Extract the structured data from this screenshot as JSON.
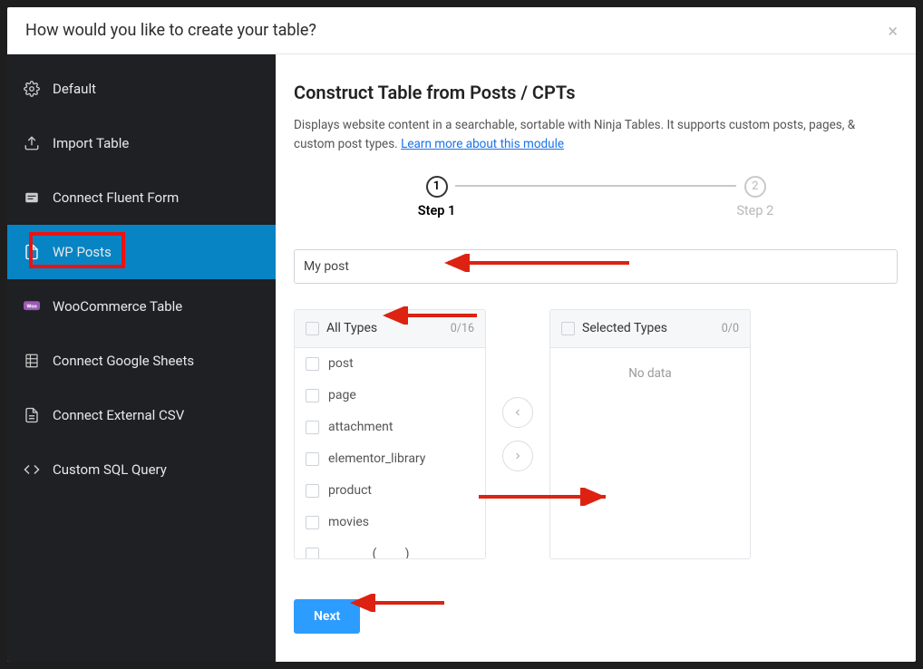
{
  "modal": {
    "title": "How would you like to create your table?"
  },
  "sidebar": {
    "items": [
      {
        "label": "Default"
      },
      {
        "label": "Import Table"
      },
      {
        "label": "Connect Fluent Form"
      },
      {
        "label": "WP Posts",
        "active": true
      },
      {
        "label": "WooCommerce Table"
      },
      {
        "label": "Connect Google Sheets"
      },
      {
        "label": "Connect External CSV"
      },
      {
        "label": "Custom SQL Query"
      }
    ]
  },
  "main": {
    "heading": "Construct Table from Posts / CPTs",
    "descPrefix": "Displays website content in a searchable, sortable with Ninja Tables. It supports custom posts, pages, & custom post types. ",
    "descLink": "Learn more about this module",
    "step1": "Step 1",
    "step2": "Step 2",
    "nameValue": "My post",
    "nextLabel": "Next"
  },
  "transfer": {
    "left": {
      "title": "All Types",
      "count": "0/16",
      "items": [
        "post",
        "page",
        "attachment",
        "elementor_library",
        "product",
        "movies"
      ]
    },
    "right": {
      "title": "Selected Types",
      "count": "0/0",
      "noData": "No data"
    }
  }
}
